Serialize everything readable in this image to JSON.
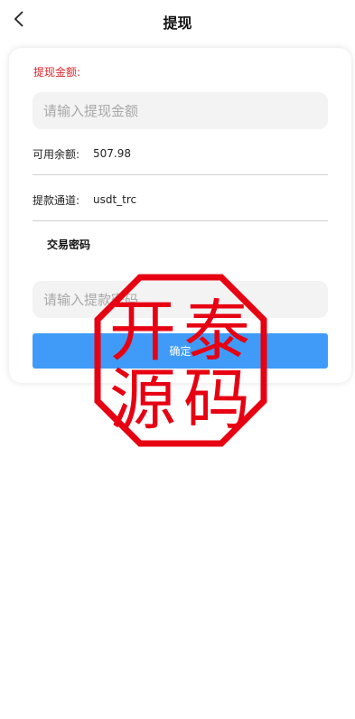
{
  "header": {
    "title": "提现",
    "back_icon": "chevron-left-icon"
  },
  "form": {
    "amount_label": "提现金额:",
    "amount_placeholder": "请输入提现金额",
    "balance_label": "可用余额:",
    "balance_value": "507.98",
    "channel_label": "提款通道:",
    "channel_value": "usdt_trc",
    "password_label": "交易密码",
    "password_placeholder": "请输入提款密码",
    "confirm_label": "确定"
  },
  "watermark": {
    "text": "开泰源码",
    "color": "#e60012"
  },
  "colors": {
    "accent": "#3f9bf7",
    "label_red": "#d9262c"
  }
}
